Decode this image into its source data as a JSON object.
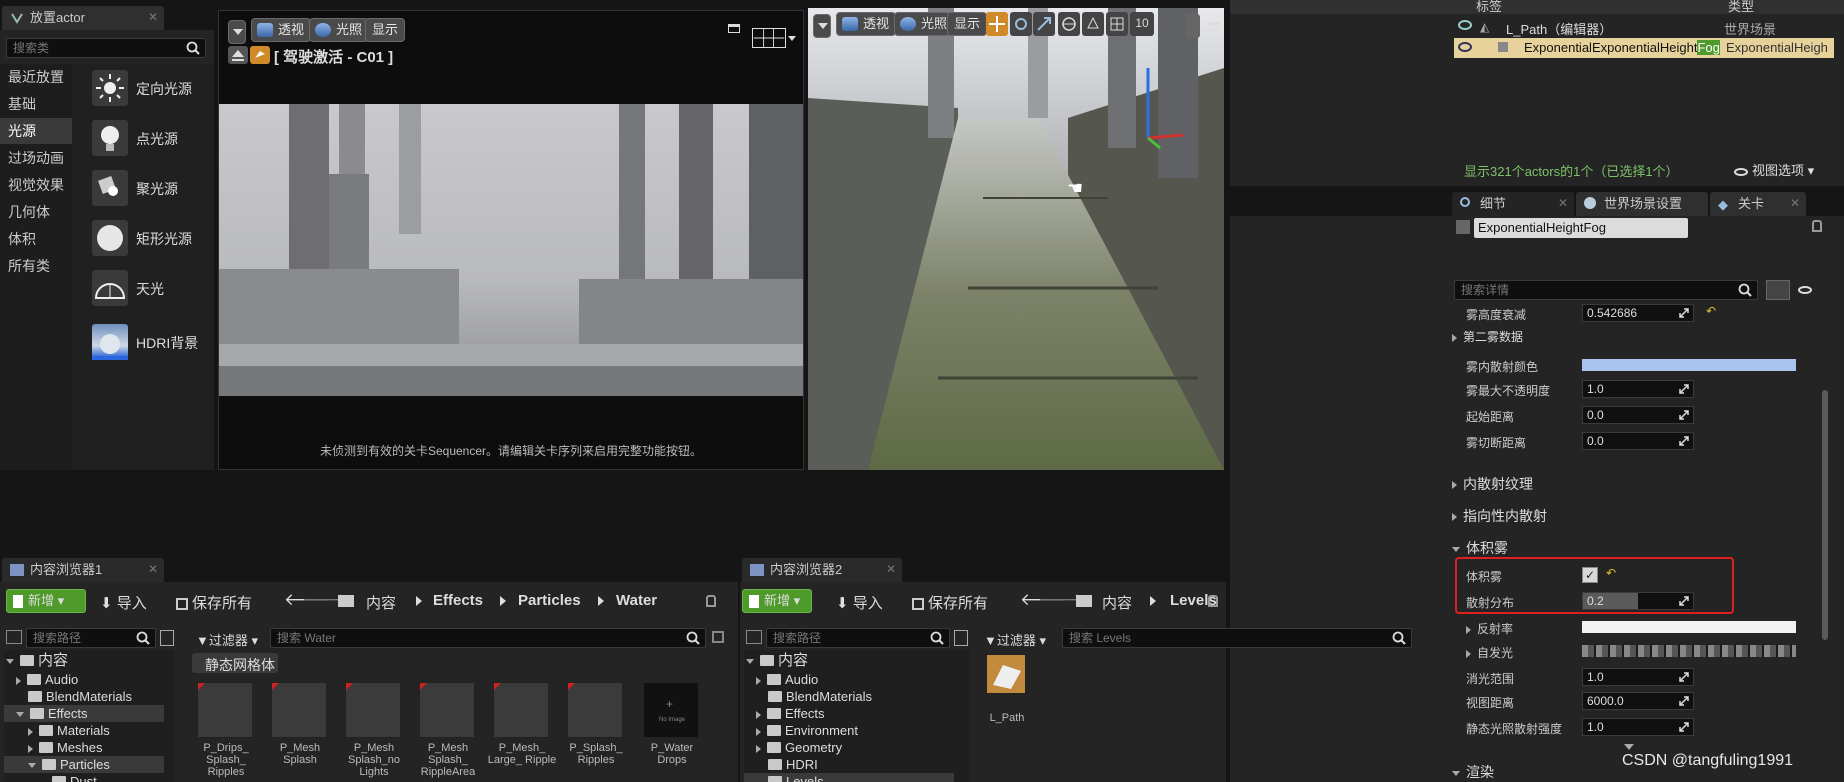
{
  "place_actor": {
    "tab": "放置actor",
    "search_placeholder": "搜索类",
    "categories": [
      "最近放置",
      "基础",
      "光源",
      "过场动画",
      "视觉效果",
      "几何体",
      "体积",
      "所有类"
    ],
    "lights": [
      "定向光源",
      "点光源",
      "聚光源",
      "矩形光源",
      "天光",
      "HDRI背景"
    ]
  },
  "vp1": {
    "btn_persp": "透视",
    "btn_lit": "光照",
    "btn_show": "显示",
    "camera_label": "[ 驾驶激活 - C01 ]",
    "message": "未侦测到有效的关卡Sequencer。请编辑关卡序列来启用完整功能按钮。"
  },
  "vp2": {
    "btn_persp": "透视",
    "btn_lit": "光照",
    "btn_show": "显示",
    "grid_num": "10"
  },
  "outliner": {
    "col_label": "标签",
    "col_type": "类型",
    "row1_name": "L_Path（编辑器）",
    "row1_type": "世界场景",
    "row2_name_a": "ExponentialExponentialHeight",
    "row2_name_b": "Fog",
    "row2_type": "ExponentialHeigh",
    "status": "显示321个actors的1个（已选择1个）",
    "view_options": "视图选项"
  },
  "details": {
    "tab_details": "细节",
    "tab_world": "世界场景设置",
    "tab_level": "关卡",
    "actor_name": "ExponentialHeightFog",
    "search_placeholder": "搜索详情",
    "p_falloff_l": "雾高度衰减",
    "p_falloff_v": "0.542686",
    "s_second": "第二雾数据",
    "p_scatter_color_l": "雾内散射颜色",
    "scatter_color": "#a9c4ef",
    "p_max_opacity_l": "雾最大不透明度",
    "p_max_opacity_v": "1.0",
    "p_start_l": "起始距离",
    "p_start_v": "0.0",
    "p_cutoff_l": "雾切断距离",
    "p_cutoff_v": "0.0",
    "s_inscatter_tex": "内散射纹理",
    "s_directional": "指向性内散射",
    "s_volumetric": "体积雾",
    "p_vol_l": "体积雾",
    "p_dist_l": "散射分布",
    "p_dist_v": "0.2",
    "p_albedo_l": "反射率",
    "albedo_color": "#f2f2f2",
    "p_emissive_l": "自发光",
    "p_extinction_l": "消光范围",
    "p_extinction_v": "1.0",
    "p_viewdist_l": "视图距离",
    "p_viewdist_v": "6000.0",
    "p_static_l": "静态光照散射强度",
    "p_static_v": "1.0",
    "s_render": "渲染"
  },
  "cb1": {
    "tab": "内容浏览器1",
    "btn_new": "新增",
    "btn_import": "导入",
    "btn_save": "保存所有",
    "crumbs": [
      "内容",
      "Effects",
      "Particles",
      "Water"
    ],
    "search_path": "搜索路径",
    "filter": "过滤器",
    "search_assets": "搜索 Water",
    "group": "静态网格体",
    "tree": [
      "内容",
      "Audio",
      "BlendMaterials",
      "Effects",
      "Materials",
      "Meshes",
      "Particles",
      "Dust"
    ],
    "assets": [
      "P_Drips_ Splash_ Ripples",
      "P_Mesh Splash",
      "P_Mesh Splash_no Lights",
      "P_Mesh Splash_ RippleArea",
      "P_Mesh_ Large_ Ripple",
      "P_Splash_ Ripples",
      "P_Water Drops"
    ],
    "noimage": "No Image"
  },
  "cb2": {
    "tab": "内容浏览器2",
    "btn_new": "新增",
    "btn_import": "导入",
    "btn_save": "保存所有",
    "crumbs": [
      "内容",
      "Levels"
    ],
    "search_path": "搜索路径",
    "filter": "过滤器",
    "search_assets": "搜索 Levels",
    "tree": [
      "内容",
      "Audio",
      "BlendMaterials",
      "Effects",
      "Environment",
      "Geometry",
      "HDRI",
      "Levels"
    ],
    "asset": "L_Path"
  },
  "watermark": "CSDN @tangfuling1991",
  "colors": {
    "accent_green": "#4e9a2a",
    "highlight_yellow": "#e6d29a",
    "selection_red": "#e02020"
  }
}
